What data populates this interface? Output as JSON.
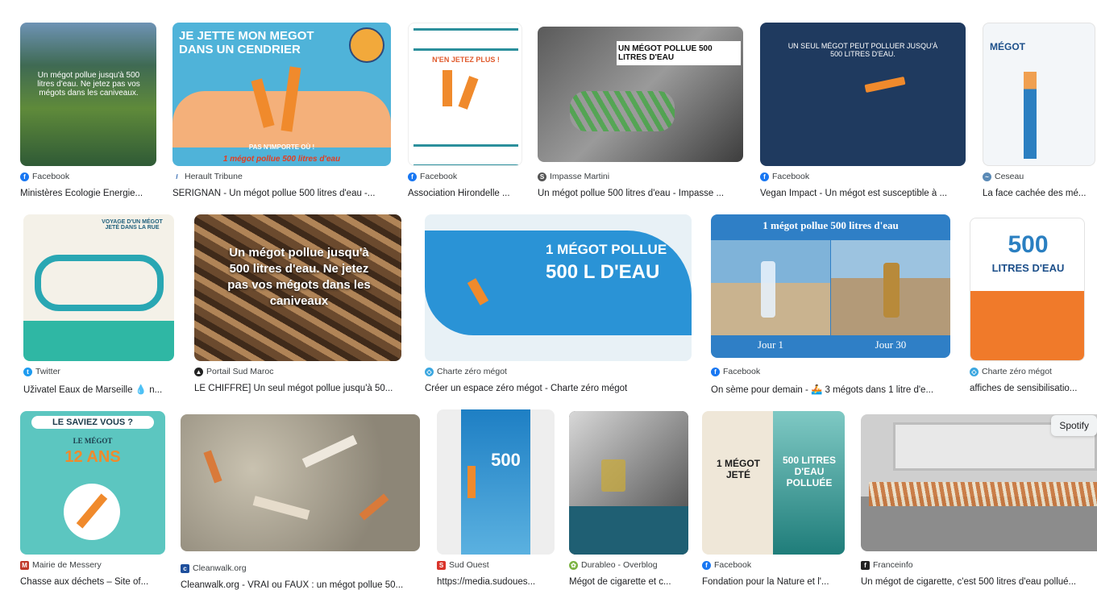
{
  "results": [
    {
      "source": "Facebook",
      "title": "Ministères Écologie Énergie...",
      "thumb_text": "Un mégot pollue jusqu'à 500 litres d'eau. Ne jetez pas vos mégots dans les caniveaux.",
      "fav": "facebook-icon"
    },
    {
      "source": "Herault Tribune",
      "title": "SERIGNAN - Un mégot pollue 500 litres d'eau -...",
      "thumb_text": "JE JETTE MON MEGOT DANS UN CENDRIER",
      "thumb_sub": "1 mégot pollue 500 litres d'eau",
      "thumb_sub2": "PAS N'IMPORTE OÙ !",
      "fav": "herault-icon"
    },
    {
      "source": "Facebook",
      "title": "Association Hirondelle ...",
      "thumb_text": "N'EN JETEZ PLUS !",
      "fav": "facebook-icon"
    },
    {
      "source": "Impasse Martini",
      "title": "Un mégot pollue 500 litres d'eau - Impasse ...",
      "thumb_text": "UN MÉGOT POLLUE 500 LITRES D'EAU",
      "fav": "impasse-icon"
    },
    {
      "source": "Facebook",
      "title": "Vegan Impact - Un mégot est susceptible à ...",
      "thumb_text": "UN SEUL MÉGOT PEUT POLLUER JUSQU'À 500 LITRES D'EAU.",
      "fav": "facebook-icon"
    },
    {
      "source": "Ceseau",
      "title": "La face cachée des mé...",
      "thumb_text": "MÉGOT",
      "fav": "ceseau-icon"
    },
    {
      "source": "Twitter",
      "title": "Uživatel Eaux de Marseille 💧 n...",
      "thumb_text": "VOYAGE D'UN MÉGOT JETÉ DANS LA RUE",
      "fav": "twitter-icon"
    },
    {
      "source": "Portail Sud Maroc",
      "title": "LE CHIFFRE] Un seul mégot pollue jusqu'à 50...",
      "thumb_text": "Un mégot pollue jusqu'à 500 litres d'eau. Ne jetez pas vos mégots dans les caniveaux",
      "fav": "portail-icon"
    },
    {
      "source": "Charte zéro mégot",
      "title": "Créer un espace zéro mégot - Charte zéro mégot",
      "thumb_text": "1 MÉGOT POLLUE",
      "thumb_sub": "500 L D'EAU",
      "fav": "charte-icon"
    },
    {
      "source": "Facebook",
      "title": "On sème pour demain - 🚣 3 mégots dans 1 litre d'e...",
      "thumb_text": "1 mégot pollue 500 litres d'eau",
      "thumb_sub": "Jour 1",
      "thumb_sub2": "Jour 30",
      "fav": "facebook-icon"
    },
    {
      "source": "Charte zéro mégot",
      "title": "affiches de sensibilisatio...",
      "thumb_text": "LITRES D'EAU",
      "thumb_sub": "500",
      "fav": "charte-icon"
    },
    {
      "source": "Mairie de Messery",
      "title": "Chasse aux déchets – Site of...",
      "thumb_text": "LE SAVIEZ VOUS ?",
      "thumb_sub": "12 ANS",
      "thumb_sub2": "LE MÉGOT",
      "fav": "mairie-icon"
    },
    {
      "source": "Cleanwalk.org",
      "title": "Cleanwalk.org - VRAI ou FAUX : un mégot pollue 50...",
      "fav": "cleanwalk-icon"
    },
    {
      "source": "Sud Ouest",
      "title": "https://media.sudoues...",
      "thumb_text": "500",
      "fav": "sudouest-icon"
    },
    {
      "source": "Durableo - Overblog",
      "title": "Mégot de cigarette et c...",
      "fav": "durableo-icon"
    },
    {
      "source": "Facebook",
      "title": "Fondation pour la Nature et l'...",
      "thumb_text": "1 MÉGOT JETÉ",
      "thumb_sub": "500 LITRES D'EAU POLLUÉE",
      "fav": "facebook-icon"
    },
    {
      "source": "Franceinfo",
      "title": "Un mégot de cigarette, c'est 500 litres d'eau pollué...",
      "fav": "franceinfo-icon"
    }
  ],
  "overlay": {
    "spotify_label": "Spotify"
  },
  "colors": {
    "facebook": "#1877f2",
    "twitter": "#1d9bf0",
    "link_text": "#202124",
    "source_text": "#3c4043"
  }
}
